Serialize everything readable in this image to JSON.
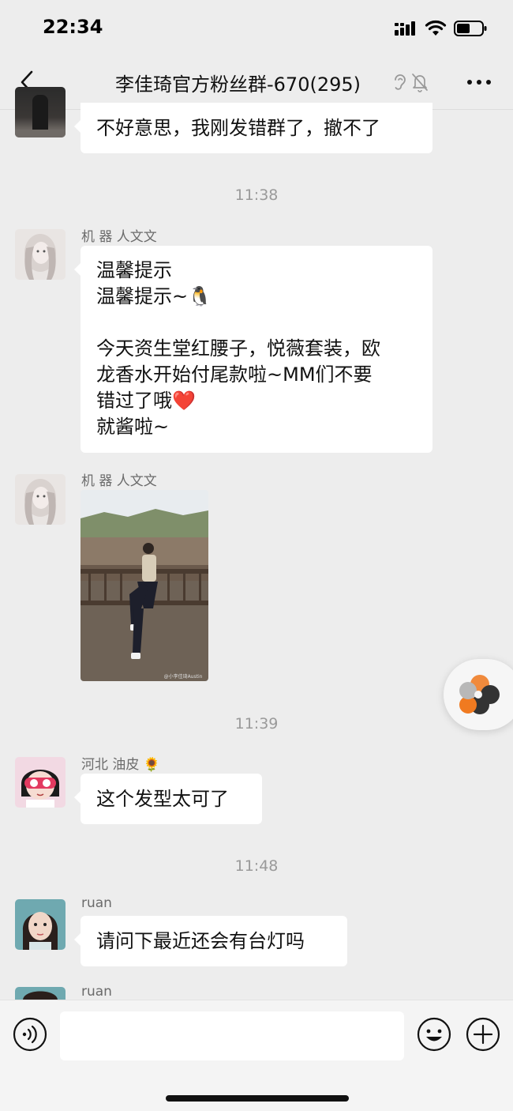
{
  "status_bar": {
    "time": "22:34"
  },
  "nav": {
    "title": "李佳琦官方粉丝群-670(295)"
  },
  "messages": {
    "m0": {
      "text": "不好意思，我刚发错群了，撤不了"
    },
    "ts1": "11:38",
    "m1": {
      "sender": "机 器 人文文",
      "lines": [
        "温馨提示",
        "温馨提示~🐧",
        "",
        "今天资生堂红腰子，悦薇套装，欧",
        "龙香水开始付尾款啦~MM们不要",
        "错过了哦❤️",
        "就酱啦~"
      ]
    },
    "m2": {
      "sender": "机 器 人文文",
      "photo_caption": "@小李佳琦Austin"
    },
    "ts2": "11:39",
    "m3": {
      "sender": "河北 油皮 🌻",
      "text": "这个发型太可了"
    },
    "ts3": "11:48",
    "m4": {
      "sender": "ruan",
      "text": "请问下最近还会有台灯吗"
    },
    "m5": {
      "sender": "ruan"
    }
  },
  "icons": {
    "back": "chevron-left-icon",
    "ear": "ear-icon",
    "mute": "bell-slash-icon",
    "more": "ellipsis-icon",
    "voice": "voice-icon",
    "emoji": "smiley-icon",
    "plus": "plus-icon"
  },
  "colors": {
    "background": "#ededed",
    "bubble": "#ffffff",
    "timestamp": "#9a9a9a"
  }
}
